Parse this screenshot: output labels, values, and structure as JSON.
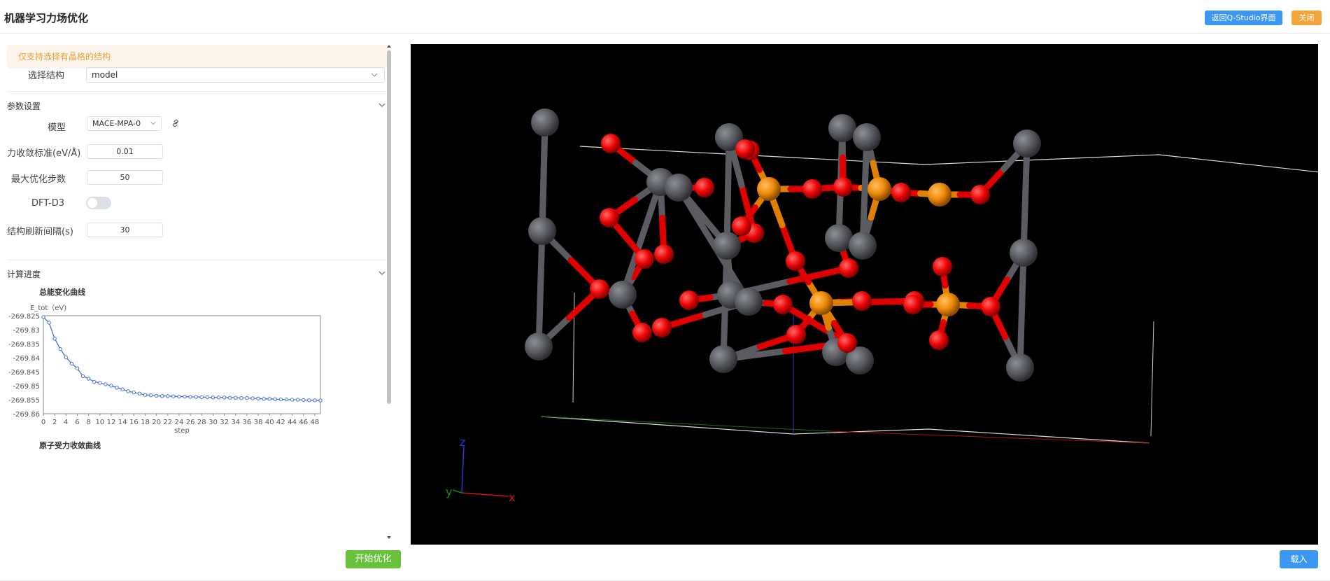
{
  "header": {
    "title": "机器学习力场优化",
    "back_label": "返回Q-Studio界面",
    "close_label": "关闭"
  },
  "notice": "仅支持选择有晶格的结构",
  "structure": {
    "label": "选择结构",
    "value": "model"
  },
  "params": {
    "section_title": "参数设置",
    "model_label": "模型",
    "model_value": "MACE-MPA-0",
    "force_label": "力收敛标准(eV/Å)",
    "force_value": "0.01",
    "steps_label": "最大优化步数",
    "steps_value": "50",
    "dft_label": "DFT-D3",
    "dft_on": false,
    "refresh_label": "结构刷新间隔(s)",
    "refresh_value": "30"
  },
  "progress": {
    "section_title": "计算进度",
    "next_chart_title": "原子受力收敛曲线"
  },
  "chart_data": {
    "type": "line",
    "title": "总能变化曲线",
    "ylabel": "E_tot（eV)",
    "xlabel": "step",
    "ylim": [
      -269.86,
      -269.825
    ],
    "xlim": [
      0,
      49
    ],
    "y_ticks": [
      "-269.825",
      "-269.83",
      "-269.835",
      "-269.84",
      "-269.845",
      "-269.85",
      "-269.855",
      "-269.86"
    ],
    "x_ticks": [
      "0",
      "2",
      "4",
      "6",
      "8",
      "10",
      "12",
      "14",
      "16",
      "18",
      "20",
      "22",
      "24",
      "26",
      "28",
      "30",
      "32",
      "34",
      "36",
      "38",
      "40",
      "42",
      "44",
      "46",
      "48"
    ],
    "x": [
      0,
      1,
      2,
      3,
      4,
      5,
      6,
      7,
      8,
      9,
      10,
      11,
      12,
      13,
      14,
      15,
      16,
      17,
      18,
      19,
      20,
      21,
      22,
      23,
      24,
      25,
      26,
      27,
      28,
      29,
      30,
      31,
      32,
      33,
      34,
      35,
      36,
      37,
      38,
      39,
      40,
      41,
      42,
      43,
      44,
      45,
      46,
      47,
      48,
      49
    ],
    "values": [
      -269.8255,
      -269.8275,
      -269.8332,
      -269.8369,
      -269.8399,
      -269.8421,
      -269.8438,
      -269.8466,
      -269.8475,
      -269.8486,
      -269.849,
      -269.8495,
      -269.85,
      -269.8507,
      -269.8513,
      -269.852,
      -269.8524,
      -269.8528,
      -269.8533,
      -269.8534,
      -269.8536,
      -269.8537,
      -269.8537,
      -269.8538,
      -269.8539,
      -269.8539,
      -269.854,
      -269.854,
      -269.8541,
      -269.8541,
      -269.8542,
      -269.8542,
      -269.8542,
      -269.8543,
      -269.8543,
      -269.8544,
      -269.8544,
      -269.8545,
      -269.8546,
      -269.8547,
      -269.8547,
      -269.8548,
      -269.8549,
      -269.8549,
      -269.855,
      -269.855,
      -269.8551,
      -269.8552,
      -269.8552,
      -269.8553
    ],
    "line_color": "#4a6fd6"
  },
  "actions": {
    "start_label": "开始优化",
    "load_label": "载入"
  },
  "viewer": {
    "axis_labels": {
      "x": "x",
      "y": "y",
      "z": "z"
    },
    "colors": {
      "background": "#000000",
      "gray_atom": "#5a5c62",
      "red_atom": "#ff1010",
      "orange_atom": "#f08c0c"
    }
  }
}
